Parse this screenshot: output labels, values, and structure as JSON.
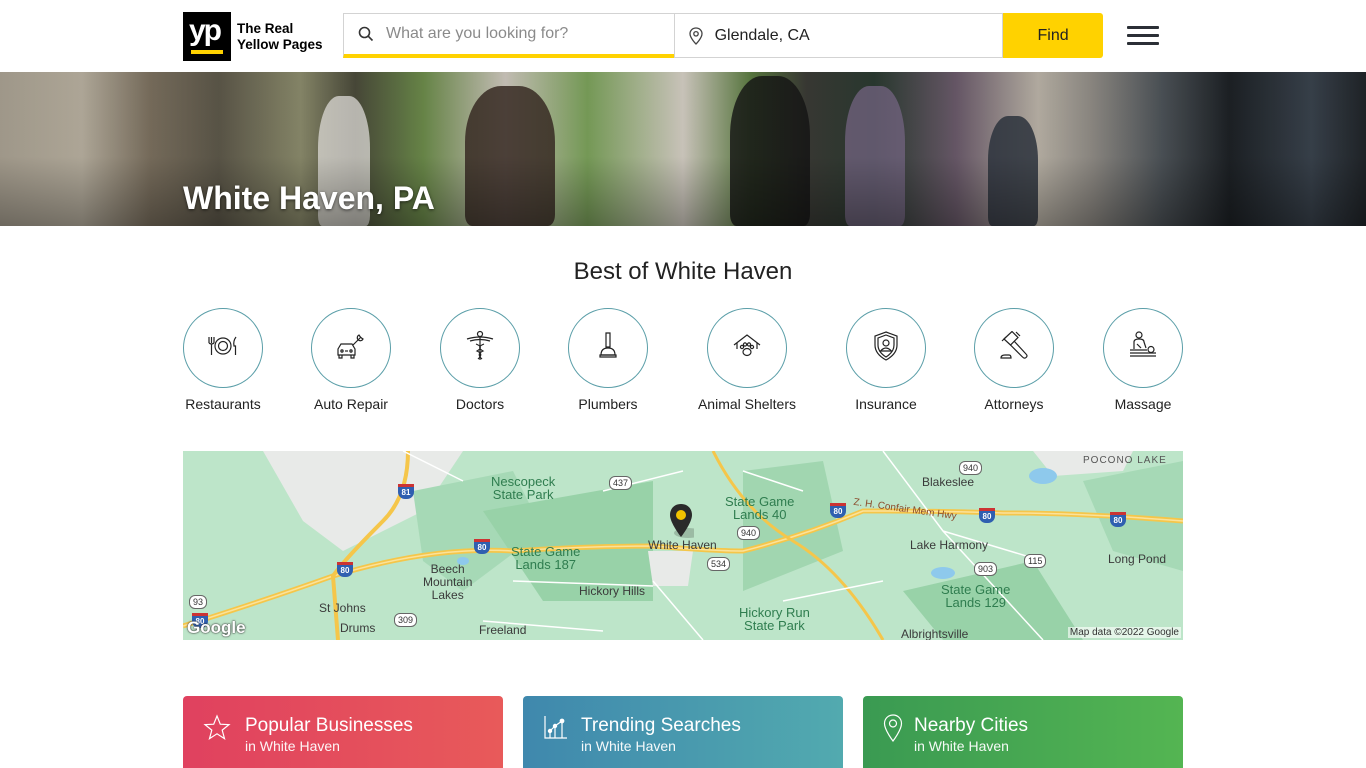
{
  "header": {
    "logo_mark": "yp",
    "logo_line1": "The Real",
    "logo_line2": "Yellow Pages",
    "search_placeholder": "What are you looking for?",
    "search_value": "",
    "location_value": "Glendale, CA",
    "find_label": "Find",
    "icons": {
      "search": "search-icon",
      "location": "map-pin-icon",
      "menu": "hamburger-menu-icon"
    }
  },
  "hero": {
    "title": "White Haven, PA"
  },
  "best_of": {
    "title": "Best of White Haven",
    "categories": [
      {
        "label": "Restaurants",
        "icon": "restaurant-icon"
      },
      {
        "label": "Auto Repair",
        "icon": "auto-repair-icon"
      },
      {
        "label": "Doctors",
        "icon": "caduceus-icon"
      },
      {
        "label": "Plumbers",
        "icon": "plunger-icon"
      },
      {
        "label": "Animal Shelters",
        "icon": "animal-shelter-icon"
      },
      {
        "label": "Insurance",
        "icon": "insurance-shield-icon"
      },
      {
        "label": "Attorneys",
        "icon": "gavel-icon"
      },
      {
        "label": "Massage",
        "icon": "massage-icon"
      }
    ]
  },
  "map": {
    "attribution": "Map data ©2022 Google",
    "google_logo": "Google",
    "marker_label": "White Haven",
    "labels": {
      "nescopeck": "Nescopeck\nState Park",
      "sgl187": "State Game\nLands 187",
      "beech": "Beech\nMountain\nLakes",
      "hickory_hills": "Hickory Hills",
      "st_johns": "St Johns",
      "drums": "Drums",
      "freeland": "Freeland",
      "white_haven": "White Haven",
      "sgl40": "State Game\nLands 40",
      "blakeslee": "Blakeslee",
      "pocono_lake": "POCONO LAKE",
      "lake_harmony": "Lake Harmony",
      "long_pond": "Long Pond",
      "sgl129": "State Game\nLands 129",
      "hickory_run": "Hickory Run\nState Park",
      "albrightsville": "Albrightsville",
      "confair": "Z. H. Confair Mem Hwy"
    },
    "shields": {
      "i81": "81",
      "i80": "80",
      "i80b": "80",
      "i80c": "80",
      "i80d": "80",
      "i80e": "80",
      "i80f": "80"
    },
    "routes": {
      "r437": "437",
      "r940a": "940",
      "r940b": "940",
      "r534": "534",
      "r903": "903",
      "r115": "115",
      "r309": "309",
      "r93": "93"
    }
  },
  "cards": [
    {
      "title": "Popular Businesses",
      "subtitle": "in White Haven",
      "icon": "star-icon",
      "color": "#e0415f"
    },
    {
      "title": "Trending Searches",
      "subtitle": "in White Haven",
      "icon": "trending-chart-icon",
      "color": "#3f88ad"
    },
    {
      "title": "Nearby Cities",
      "subtitle": "in White Haven",
      "icon": "location-pin-icon",
      "color": "#3a9a52"
    }
  ]
}
